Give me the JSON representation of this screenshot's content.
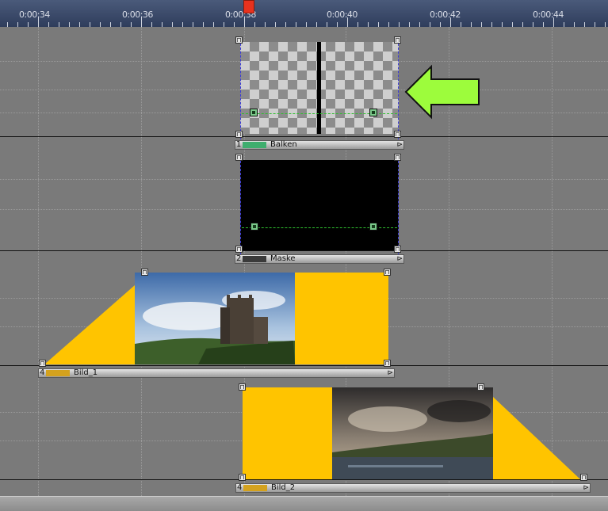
{
  "ruler": {
    "labels": [
      "0:00:34",
      "0:00:36",
      "0:00:38",
      "0:00:40",
      "0:00:42",
      "0:00:44"
    ]
  },
  "tracks": [
    {
      "number": "1",
      "name": "Balken",
      "color": "#3fae6e"
    },
    {
      "number": "2",
      "name": "Maske",
      "color": "#3a3a3a"
    },
    {
      "number": "4",
      "name": "Bild_1",
      "color": "#d4a21e"
    },
    {
      "number": "4",
      "name": "Bild_2",
      "color": "#d4a21e"
    }
  ],
  "colors": {
    "transition_fill": "#ffc400",
    "arrow_fill": "#9dfc3c",
    "playhead": "#e8321e",
    "ruler_bg": "#2f3d5c"
  },
  "icons": {
    "arrow": "green-arrow-left-icon",
    "handle": "clip-handle-icon",
    "keyframe": "keyframe-icon",
    "clip_end": "clip-end-arrow-icon"
  },
  "glyphs": {
    "handle": "⊓",
    "clip_end": "⊳"
  }
}
